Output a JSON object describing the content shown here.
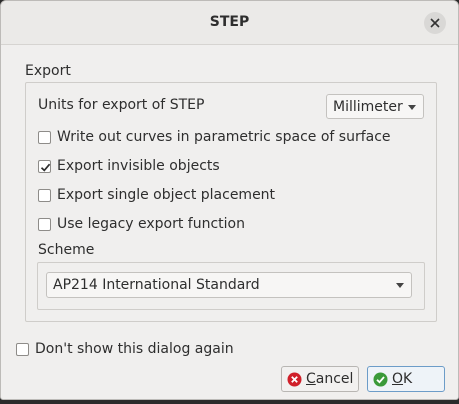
{
  "window": {
    "title": "STEP",
    "close_icon": "close-icon"
  },
  "export": {
    "group_title": "Export",
    "units_label": "Units for export of STEP",
    "units_value": "Millimeter",
    "options": [
      {
        "label": "Write out curves in parametric space of surface",
        "checked": false
      },
      {
        "label": "Export invisible objects",
        "checked": true
      },
      {
        "label": "Export single object placement",
        "checked": false
      },
      {
        "label": "Use legacy export function",
        "checked": false
      }
    ],
    "scheme_label": "Scheme",
    "scheme_value": "AP214 International Standard"
  },
  "footer": {
    "dont_show_label": "Don't show this dialog again",
    "dont_show_checked": false,
    "cancel": {
      "mnemonic": "C",
      "rest": "ancel",
      "icon": "cancel-icon",
      "color": "#d0202a"
    },
    "ok": {
      "mnemonic": "O",
      "rest": "K",
      "icon": "ok-icon",
      "color": "#3a9a3a"
    }
  }
}
